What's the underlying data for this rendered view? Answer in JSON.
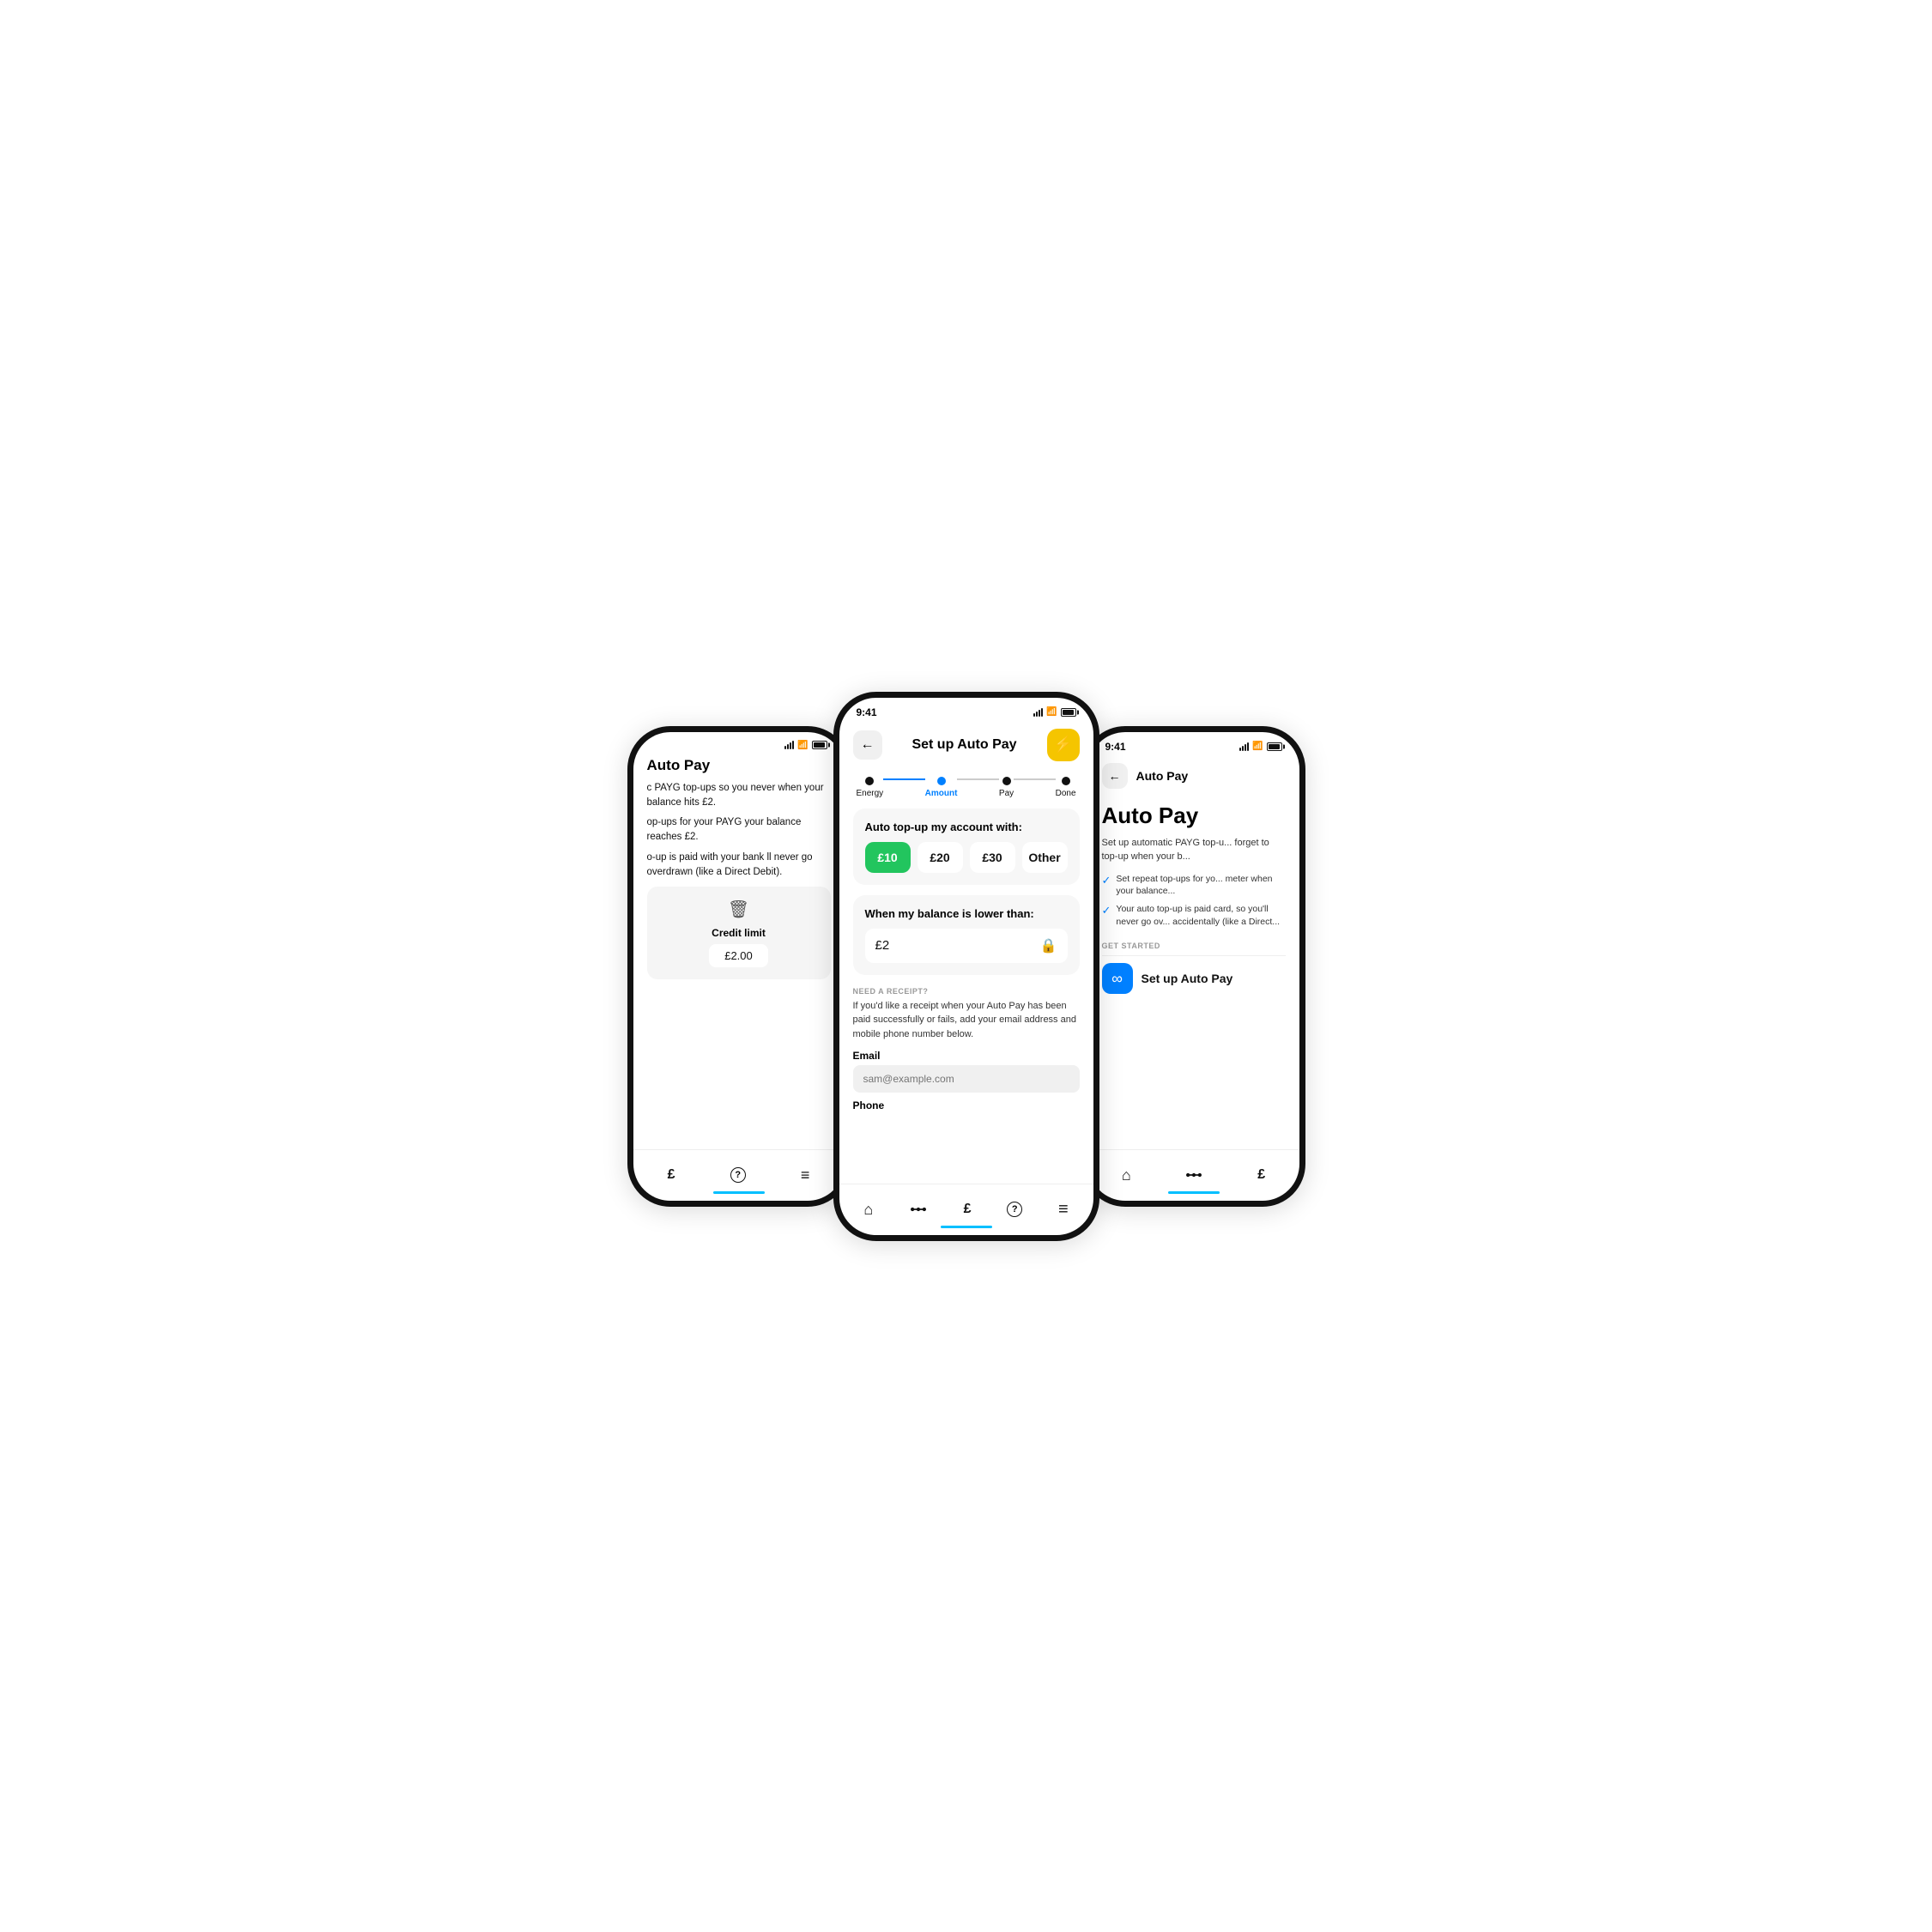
{
  "left_phone": {
    "title": "Auto Pay",
    "desc1": "c PAYG top-ups so you never when your balance hits £2.",
    "desc2": "op-ups for your PAYG your balance reaches £2.",
    "desc3": "o-up is paid with your bank ll never go overdrawn (like a Direct Debit).",
    "credit_label": "Credit limit",
    "credit_value": "£2.00",
    "nav": {
      "pound": "£",
      "help": "?",
      "menu": "≡"
    }
  },
  "center_phone": {
    "time": "9:41",
    "header_title": "Set up Auto Pay",
    "steps": [
      {
        "label": "Energy",
        "state": "done"
      },
      {
        "label": "Amount",
        "state": "active"
      },
      {
        "label": "Pay",
        "state": "default"
      },
      {
        "label": "Done",
        "state": "default"
      }
    ],
    "topup_title": "Auto top-up my account with:",
    "amounts": [
      {
        "value": "£10",
        "selected": true
      },
      {
        "value": "£20",
        "selected": false
      },
      {
        "value": "£30",
        "selected": false
      },
      {
        "value": "Other",
        "selected": false
      }
    ],
    "balance_title": "When my balance is lower than:",
    "balance_value": "£2",
    "receipt_label": "NEED A RECEIPT?",
    "receipt_desc": "If you'd like a receipt when your Auto Pay has been paid successfully or fails, add your email address and mobile phone number below.",
    "email_label": "Email",
    "email_placeholder": "sam@example.com",
    "phone_label": "Phone",
    "nav": {
      "home": "⌂",
      "track": "track",
      "pound": "£",
      "help": "?",
      "menu": "≡"
    }
  },
  "right_phone": {
    "time": "9:41",
    "header_title": "Auto Pay",
    "main_title": "Auto Pay",
    "desc": "Set up automatic PAYG top-u... forget to top-up when your b...",
    "check1": "Set repeat top-ups for yo... meter when your balance...",
    "check2": "Your auto top-up is paid card, so you'll never go ov... accidentally (like a Direct...",
    "get_started_label": "GET STARTED",
    "setup_btn_label": "Set up Auto Pay",
    "nav": {
      "home": "⌂",
      "track": "track",
      "pound": "£"
    }
  },
  "icons": {
    "back": "←",
    "lightning": "⚡",
    "lock": "🔒",
    "trash": "🗑",
    "infinity": "∞",
    "check": "✓"
  }
}
